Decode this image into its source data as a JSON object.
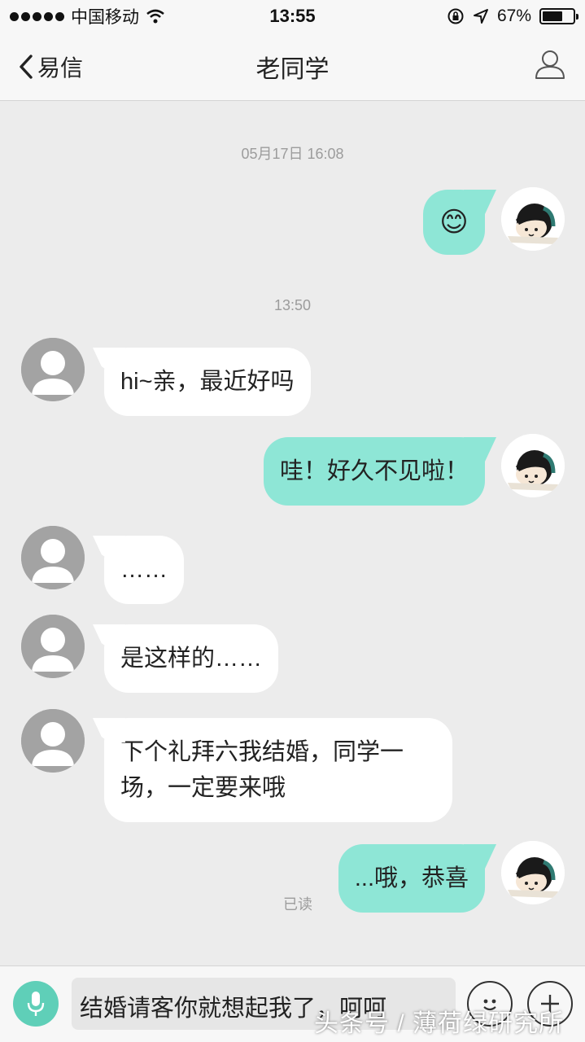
{
  "status_bar": {
    "carrier": "中国移动",
    "time": "13:55",
    "battery": "67%",
    "battery_level": 0.67,
    "icons": [
      "signal-icon",
      "wifi-icon",
      "rotation-lock-icon",
      "location-icon",
      "battery-icon"
    ]
  },
  "nav": {
    "back_label": "易信",
    "title": "老同学",
    "icons": [
      "chevron-left-icon",
      "profile-icon"
    ]
  },
  "chat": {
    "timestamps": [
      "05月17日 16:08",
      "13:50"
    ],
    "messages": [
      {
        "side": "right",
        "type": "emoji",
        "text": "😊"
      },
      {
        "side": "left",
        "text": "hi~亲，最近好吗"
      },
      {
        "side": "right",
        "text": "哇！好久不见啦！"
      },
      {
        "side": "left",
        "text": "……"
      },
      {
        "side": "left",
        "text": "是这样的……"
      },
      {
        "side": "left",
        "text": "下个礼拜六我结婚，同学一场，一定要来哦"
      },
      {
        "side": "right",
        "text": "...哦，恭喜"
      }
    ],
    "read_receipt": "已读"
  },
  "input_bar": {
    "draft": "结婚请客你就想起我了，呵呵",
    "icons": [
      "microphone-icon",
      "emoji-icon",
      "plus-icon"
    ]
  },
  "watermark": "头条号 / 薄荷绿研究所",
  "colors": {
    "bubble_mine": "#8ee6d6",
    "bubble_theirs": "#ffffff",
    "background": "#ececec",
    "accent": "#5fcfb8"
  }
}
